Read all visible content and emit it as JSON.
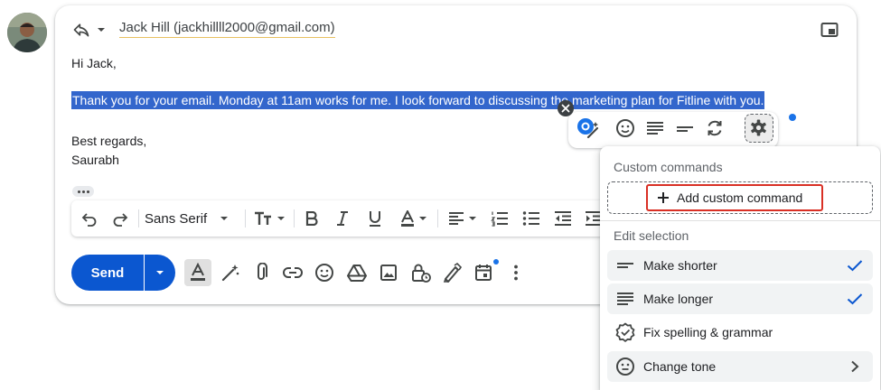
{
  "reply": {
    "recipient": "Jack Hill (jackhillll2000@gmail.com)"
  },
  "message": {
    "greeting": "Hi Jack,",
    "selected_text": "Thank you for your email. Monday at 11am works for me. I look forward to discussing the marketing plan for Fitline with you.",
    "signoff": "Best regards,",
    "signature": "Saurabh"
  },
  "format_toolbar": {
    "font_name": "Sans Serif"
  },
  "send": {
    "label": "Send"
  },
  "menu": {
    "custom_heading": "Custom commands",
    "add_custom_label": "Add custom command",
    "edit_heading": "Edit selection",
    "items": [
      {
        "label": "Make shorter",
        "icon": "short-lines-icon",
        "trailing": "check-icon"
      },
      {
        "label": "Make longer",
        "icon": "long-lines-icon",
        "trailing": "check-icon"
      },
      {
        "label": "Fix spelling & grammar",
        "icon": "badge-check-icon",
        "trailing": ""
      },
      {
        "label": "Change tone",
        "icon": "smiley-icon",
        "trailing": "chevron-right-icon"
      }
    ]
  },
  "colors": {
    "primary_blue": "#0b57d0",
    "selection_blue": "#3366cc",
    "highlight_red": "#d93025"
  }
}
